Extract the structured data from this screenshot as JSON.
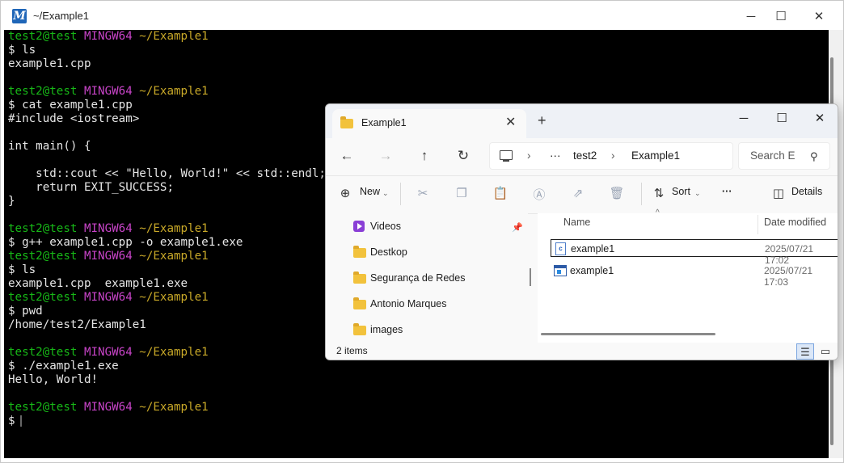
{
  "terminal": {
    "title": "~/Example1",
    "prompt": {
      "user": "test2@test",
      "host": "MINGW64",
      "path": "~/Example1"
    },
    "lines": [
      {
        "type": "prompt"
      },
      {
        "type": "text",
        "text": "$ ls"
      },
      {
        "type": "text",
        "text": "example1.cpp"
      },
      {
        "type": "blank"
      },
      {
        "type": "prompt"
      },
      {
        "type": "text",
        "text": "$ cat example1.cpp"
      },
      {
        "type": "text",
        "text": "#include <iostream>"
      },
      {
        "type": "blank"
      },
      {
        "type": "text",
        "text": "int main() {"
      },
      {
        "type": "blank"
      },
      {
        "type": "text",
        "text": "    std::cout << \"Hello, World!\" << std::endl;"
      },
      {
        "type": "text",
        "text": "    return EXIT_SUCCESS;"
      },
      {
        "type": "text",
        "text": "}"
      },
      {
        "type": "blank"
      },
      {
        "type": "prompt"
      },
      {
        "type": "text",
        "text": "$ g++ example1.cpp -o example1.exe"
      },
      {
        "type": "prompt"
      },
      {
        "type": "text",
        "text": "$ ls"
      },
      {
        "type": "text",
        "text": "example1.cpp  example1.exe"
      },
      {
        "type": "prompt"
      },
      {
        "type": "text",
        "text": "$ pwd"
      },
      {
        "type": "text",
        "text": "/home/test2/Example1"
      },
      {
        "type": "blank"
      },
      {
        "type": "prompt"
      },
      {
        "type": "text",
        "text": "$ ./example1.exe"
      },
      {
        "type": "text",
        "text": "Hello, World!"
      },
      {
        "type": "blank"
      },
      {
        "type": "prompt"
      },
      {
        "type": "cursor",
        "text": "$"
      }
    ]
  },
  "explorer": {
    "tab_label": "Example1",
    "address": {
      "ellipsis": "···",
      "parts": [
        "test2",
        "Example1"
      ]
    },
    "search_placeholder": "Search E",
    "toolbar": {
      "new_label": "New",
      "sort_label": "Sort",
      "more_label": "···",
      "details_label": "Details"
    },
    "nav_items": [
      {
        "label": "Videos",
        "icon": "video-icon",
        "pinned": true
      },
      {
        "label": "Destkop",
        "icon": "folder-icon"
      },
      {
        "label": "Segurança de Redes",
        "icon": "folder-icon"
      },
      {
        "label": "Antonio Marques",
        "icon": "folder-icon"
      },
      {
        "label": "images",
        "icon": "folder-icon"
      }
    ],
    "columns": {
      "name": "Name",
      "date": "Date modified"
    },
    "files": [
      {
        "name": "example1",
        "date": "2025/07/21 17:02",
        "icon": "cpp-file-icon",
        "selected": true
      },
      {
        "name": "example1",
        "date": "2025/07/21 17:03",
        "icon": "exe-file-icon",
        "selected": false
      }
    ],
    "status": "2 items"
  },
  "colors": {
    "prompt_user": "#17b817",
    "prompt_host": "#c844c8",
    "prompt_path": "#c8a828"
  }
}
